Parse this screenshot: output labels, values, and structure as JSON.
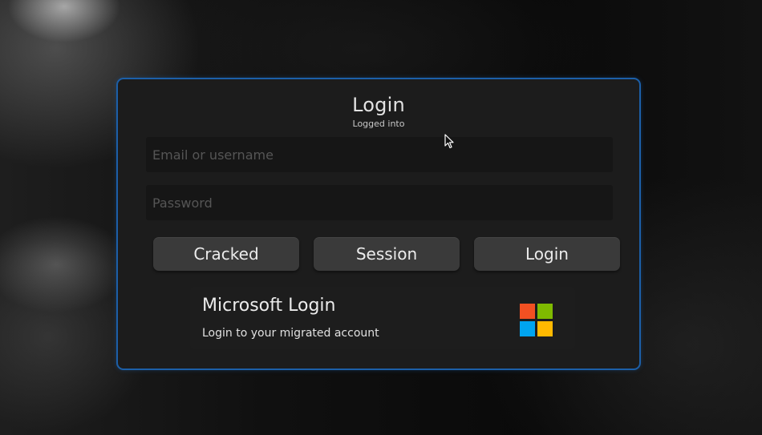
{
  "login_panel": {
    "title": "Login",
    "subtitle": "Logged into",
    "email_placeholder": "Email or username",
    "password_placeholder": "Password",
    "buttons": {
      "cracked": "Cracked",
      "session": "Session",
      "login": "Login"
    },
    "microsoft": {
      "title": "Microsoft Login",
      "description": "Login to your migrated account",
      "logo_icon": "microsoft-logo-icon",
      "logo_colors": [
        "#f25022",
        "#7fba00",
        "#00a4ef",
        "#ffb900"
      ]
    },
    "border_color": "#1c5fa8"
  },
  "cursor": {
    "icon": "mouse-pointer-icon"
  }
}
